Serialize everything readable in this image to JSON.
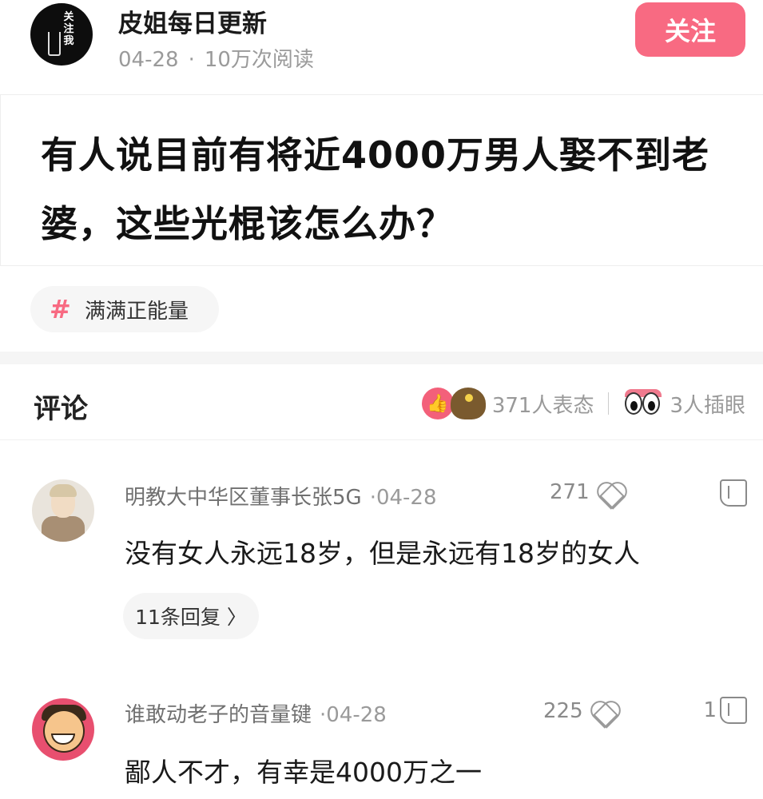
{
  "author": {
    "name": "皮姐每日更新",
    "date": "04-28",
    "separator": "·",
    "reads": "10万次阅读",
    "avatar_text": "关注我",
    "follow_label": "关注"
  },
  "post": {
    "title": "有人说目前有将近4000万男人娶不到老婆，这些光棍该怎么办？"
  },
  "tag": {
    "icon": "#",
    "label": "满满正能量"
  },
  "comments_section": {
    "title": "评论",
    "reactions_count": "371人表态",
    "eyes_count": "3人插眼"
  },
  "comments": [
    {
      "user": "明教大中华区董事长张5G",
      "date": "·04-28",
      "likes": "271",
      "dislikes": "",
      "text": "没有女人永远18岁，但是永远有18岁的女人",
      "replies": "11条回复 〉"
    },
    {
      "user": "谁敢动老子的音量键",
      "date": "·04-28",
      "likes": "225",
      "dislikes": "1",
      "text": "鄙人不才，有幸是4000万之一"
    }
  ],
  "colors": {
    "accent": "#f86a82",
    "muted": "#9a9a9a"
  }
}
